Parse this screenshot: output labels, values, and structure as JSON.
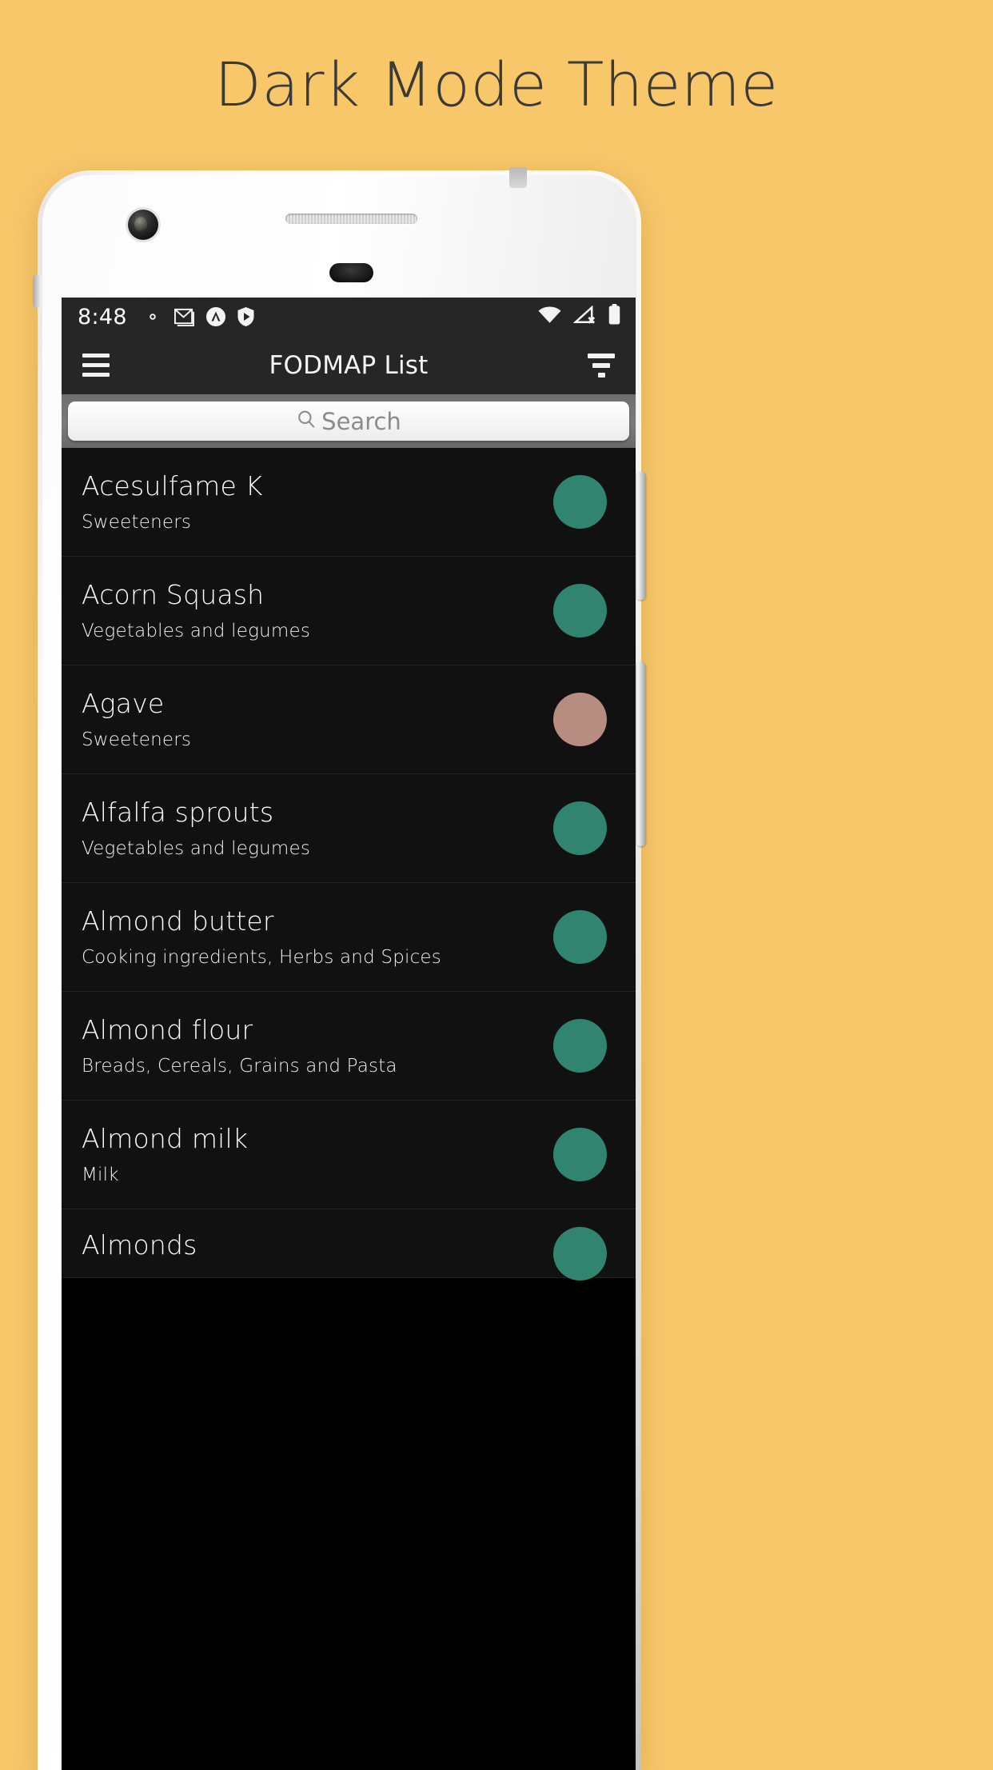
{
  "headline": "Dark Mode Theme",
  "status_bar": {
    "time": "8:48",
    "left_icons": [
      "gear-icon",
      "gmail-icon",
      "circle-caret-up-icon",
      "shield-play-icon"
    ],
    "right_icons": [
      "wifi-icon",
      "cell-signal-no-sim-icon",
      "battery-full-icon"
    ],
    "background": "#262626",
    "foreground": "#ffffff"
  },
  "app_bar": {
    "menu_label": "menu",
    "title": "FODMAP List",
    "filter_label": "filter",
    "background": "#262626"
  },
  "search": {
    "placeholder": "Search",
    "value": "",
    "icon": "search-icon"
  },
  "colors": {
    "page_background": "#f8c76a",
    "headline_text": "#3a3a38",
    "row_background": "#111111",
    "row_divider": "#242424",
    "dot_green": "#318470",
    "dot_rose": "#b78d82"
  },
  "list": {
    "items": [
      {
        "name": "Acesulfame K",
        "category": "Sweeteners",
        "status": "low",
        "dot_color": "#318470"
      },
      {
        "name": "Acorn Squash",
        "category": "Vegetables and legumes",
        "status": "low",
        "dot_color": "#318470"
      },
      {
        "name": "Agave",
        "category": "Sweeteners",
        "status": "high",
        "dot_color": "#b78d82"
      },
      {
        "name": "Alfalfa sprouts",
        "category": "Vegetables and legumes",
        "status": "low",
        "dot_color": "#318470"
      },
      {
        "name": "Almond butter",
        "category": "Cooking ingredients, Herbs and Spices",
        "status": "low",
        "dot_color": "#318470"
      },
      {
        "name": "Almond flour",
        "category": "Breads, Cereals, Grains and Pasta",
        "status": "low",
        "dot_color": "#318470"
      },
      {
        "name": "Almond milk",
        "category": "Milk",
        "status": "low",
        "dot_color": "#318470"
      },
      {
        "name": "Almonds",
        "category": "",
        "status": "low",
        "dot_color": "#318470"
      }
    ]
  }
}
